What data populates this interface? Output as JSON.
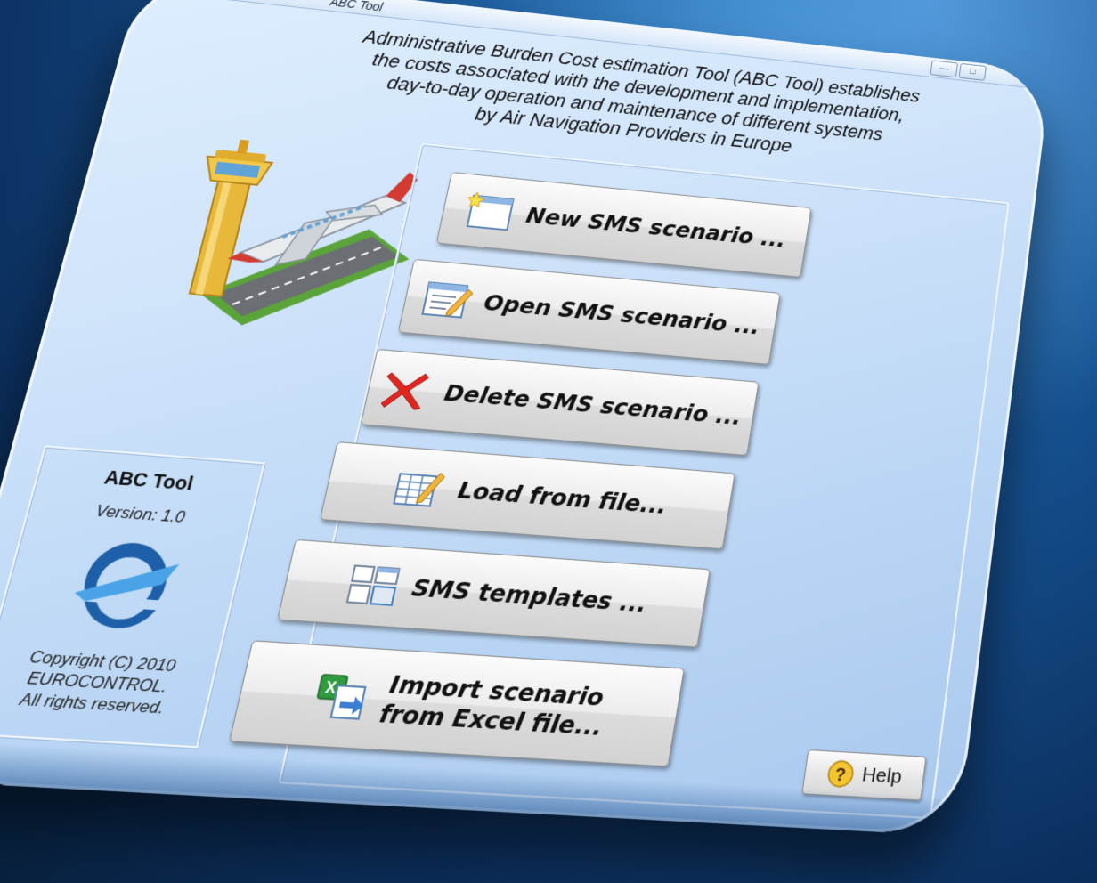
{
  "window": {
    "title": "ABC Tool",
    "controls": [
      "minimize",
      "maximize"
    ]
  },
  "description": {
    "lines": [
      "Administrative Burden Cost estimation Tool (ABC Tool) establishes",
      "the costs associated with the development and implementation,",
      "day-to-day operation and maintenance of different systems",
      "by Air Navigation Providers in Europe"
    ]
  },
  "actions": [
    {
      "label": "New SMS scenario ...",
      "icon": "new-document-icon"
    },
    {
      "label": "Open SMS scenario ...",
      "icon": "edit-document-icon"
    },
    {
      "label": "Delete SMS scenario ...",
      "icon": "delete-x-icon"
    },
    {
      "label": "Load from file...",
      "icon": "spreadsheet-edit-icon"
    },
    {
      "label": "SMS templates ...",
      "icon": "templates-icon"
    },
    {
      "label_line1": "Import scenario",
      "label_line2": "from Excel file...",
      "icon": "excel-import-icon"
    }
  ],
  "help": {
    "label": "Help",
    "icon": "help-icon"
  },
  "about": {
    "title": "ABC Tool",
    "version": "Version: 1.0",
    "copyright_line1": "Copyright (C) 2010",
    "copyright_line2": "EUROCONTROL.",
    "copyright_line3": "All rights reserved.",
    "logo": "eurocontrol-logo"
  },
  "illustration": "airport-tower-airplane-illustration",
  "colors": {
    "desktop": "#15508f",
    "window": "#cfe3fa",
    "delete_icon": "#e0261f",
    "logo_blue": "#1d5fa8"
  }
}
